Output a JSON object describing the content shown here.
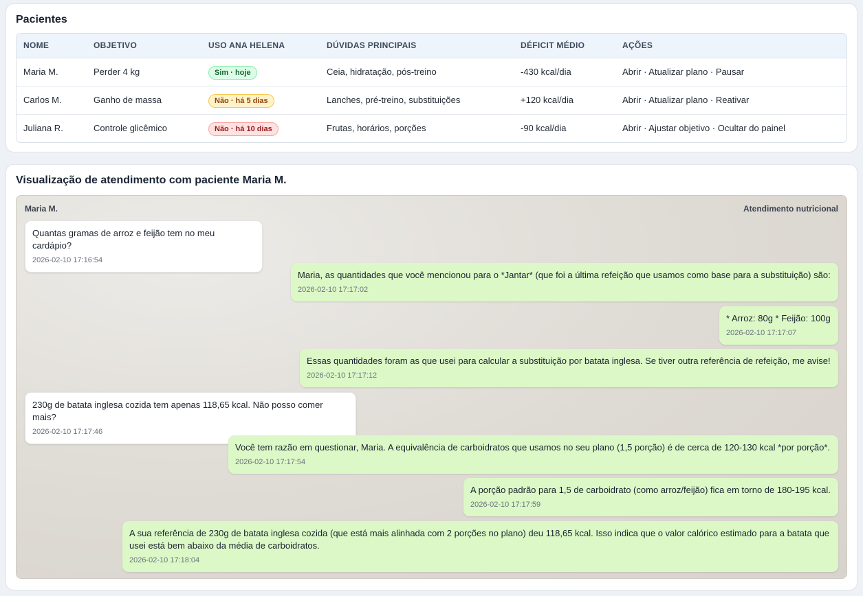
{
  "patients": {
    "title": "Pacientes",
    "columns": [
      "NOME",
      "OBJETIVO",
      "USO ANA HELENA",
      "DÚVIDAS PRINCIPAIS",
      "DÉFICIT MÉDIO",
      "AÇÕES"
    ],
    "rows": [
      {
        "name": "Maria M.",
        "goal": "Perder 4 kg",
        "usage": "Sim · hoje",
        "usage_status": "ok",
        "doubts": "Ceia, hidratação, pós-treino",
        "deficit": "-430 kcal/dia",
        "actions": [
          "Abrir",
          "Atualizar plano",
          "Pausar"
        ]
      },
      {
        "name": "Carlos M.",
        "goal": "Ganho de massa",
        "usage": "Não · há 5 dias",
        "usage_status": "warn",
        "doubts": "Lanches, pré-treino, substituições",
        "deficit": "+120 kcal/dia",
        "actions": [
          "Abrir",
          "Atualizar plano",
          "Reativar"
        ]
      },
      {
        "name": "Juliana R.",
        "goal": "Controle glicêmico",
        "usage": "Não · há 10 dias",
        "usage_status": "bad",
        "doubts": "Frutas, horários, porções",
        "deficit": "-90 kcal/dia",
        "actions": [
          "Abrir",
          "Ajustar objetivo",
          "Ocultar do painel"
        ]
      }
    ],
    "action_separator": " · "
  },
  "chat": {
    "title": "Visualização de atendimento com paciente Maria M.",
    "header_left": "Maria M.",
    "header_right": "Atendimento nutricional",
    "messages": [
      {
        "dir": "in",
        "text": "Quantas gramas de arroz e feijão tem no meu cardápio?",
        "time": "2026-02-10 17:16:54"
      },
      {
        "dir": "out",
        "text": "Maria, as quantidades que você mencionou para o *Jantar* (que foi a última refeição que usamos como base para a substituição) são:",
        "time": "2026-02-10 17:17:02"
      },
      {
        "dir": "out",
        "text": "* Arroz: 80g * Feijão: 100g",
        "time": "2026-02-10 17:17:07"
      },
      {
        "dir": "out",
        "text": "Essas quantidades foram as que usei para calcular a substituição por batata inglesa. Se tiver outra referência de refeição, me avise!",
        "time": "2026-02-10 17:17:12"
      },
      {
        "dir": "in",
        "text": "230g de batata inglesa cozida tem apenas 118,65 kcal. Não posso comer mais?",
        "time": "2026-02-10 17:17:46"
      },
      {
        "dir": "out",
        "text": "Você tem razão em questionar, Maria. A equivalência de carboidratos que usamos no seu plano (1,5 porção) é de cerca de 120-130 kcal *por porção*.",
        "time": "2026-02-10 17:17:54"
      },
      {
        "dir": "out",
        "text": "A porção padrão para 1,5 de carboidrato (como arroz/feijão) fica em torno de 180-195 kcal.",
        "time": "2026-02-10 17:17:59"
      },
      {
        "dir": "out",
        "text": "A sua referência de 230g de batata inglesa cozida (que está mais alinhada com 2 porções no plano) deu 118,65 kcal. Isso indica que o valor calórico estimado para a batata que usei está bem abaixo da média de carboidratos.",
        "time": "2026-02-10 17:18:04"
      }
    ]
  }
}
